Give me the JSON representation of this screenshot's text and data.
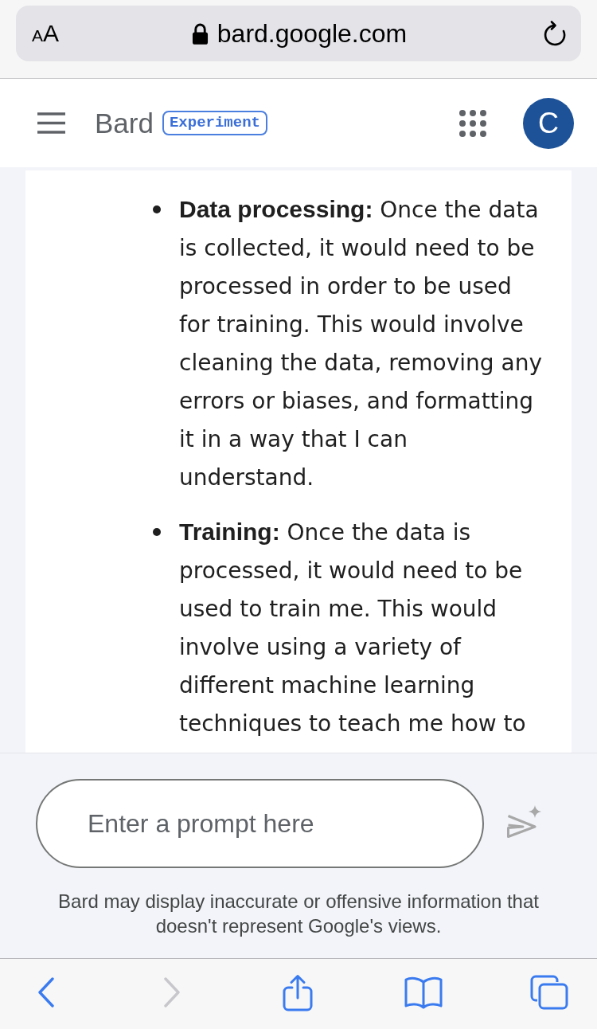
{
  "browser": {
    "text_size_button": "AA",
    "address": "bard.google.com"
  },
  "header": {
    "title": "Bard",
    "badge": "Experiment",
    "avatar_initial": "C"
  },
  "response": {
    "items": [
      {
        "text": "**Data processing:** Once the data is collected, it would need to be processed in order to be used for training. This would involve cleaning the data, removing any errors or biases, and formatting it in a way that I can understand."
      },
      {
        "text": "**Training:** Once the data is processed, it would need to be used to train me. This would involve using a variety of different machine learning techniques to teach me how to"
      }
    ]
  },
  "prompt": {
    "placeholder": "Enter a prompt here",
    "send_button": {
      "disabled": true
    }
  },
  "disclaimer": "Bard may display inaccurate or offensive information that doesn't represent Google's views.",
  "browser_toolbar": {
    "back_button": {
      "disabled": false
    },
    "forward_button": {
      "disabled": true
    }
  }
}
